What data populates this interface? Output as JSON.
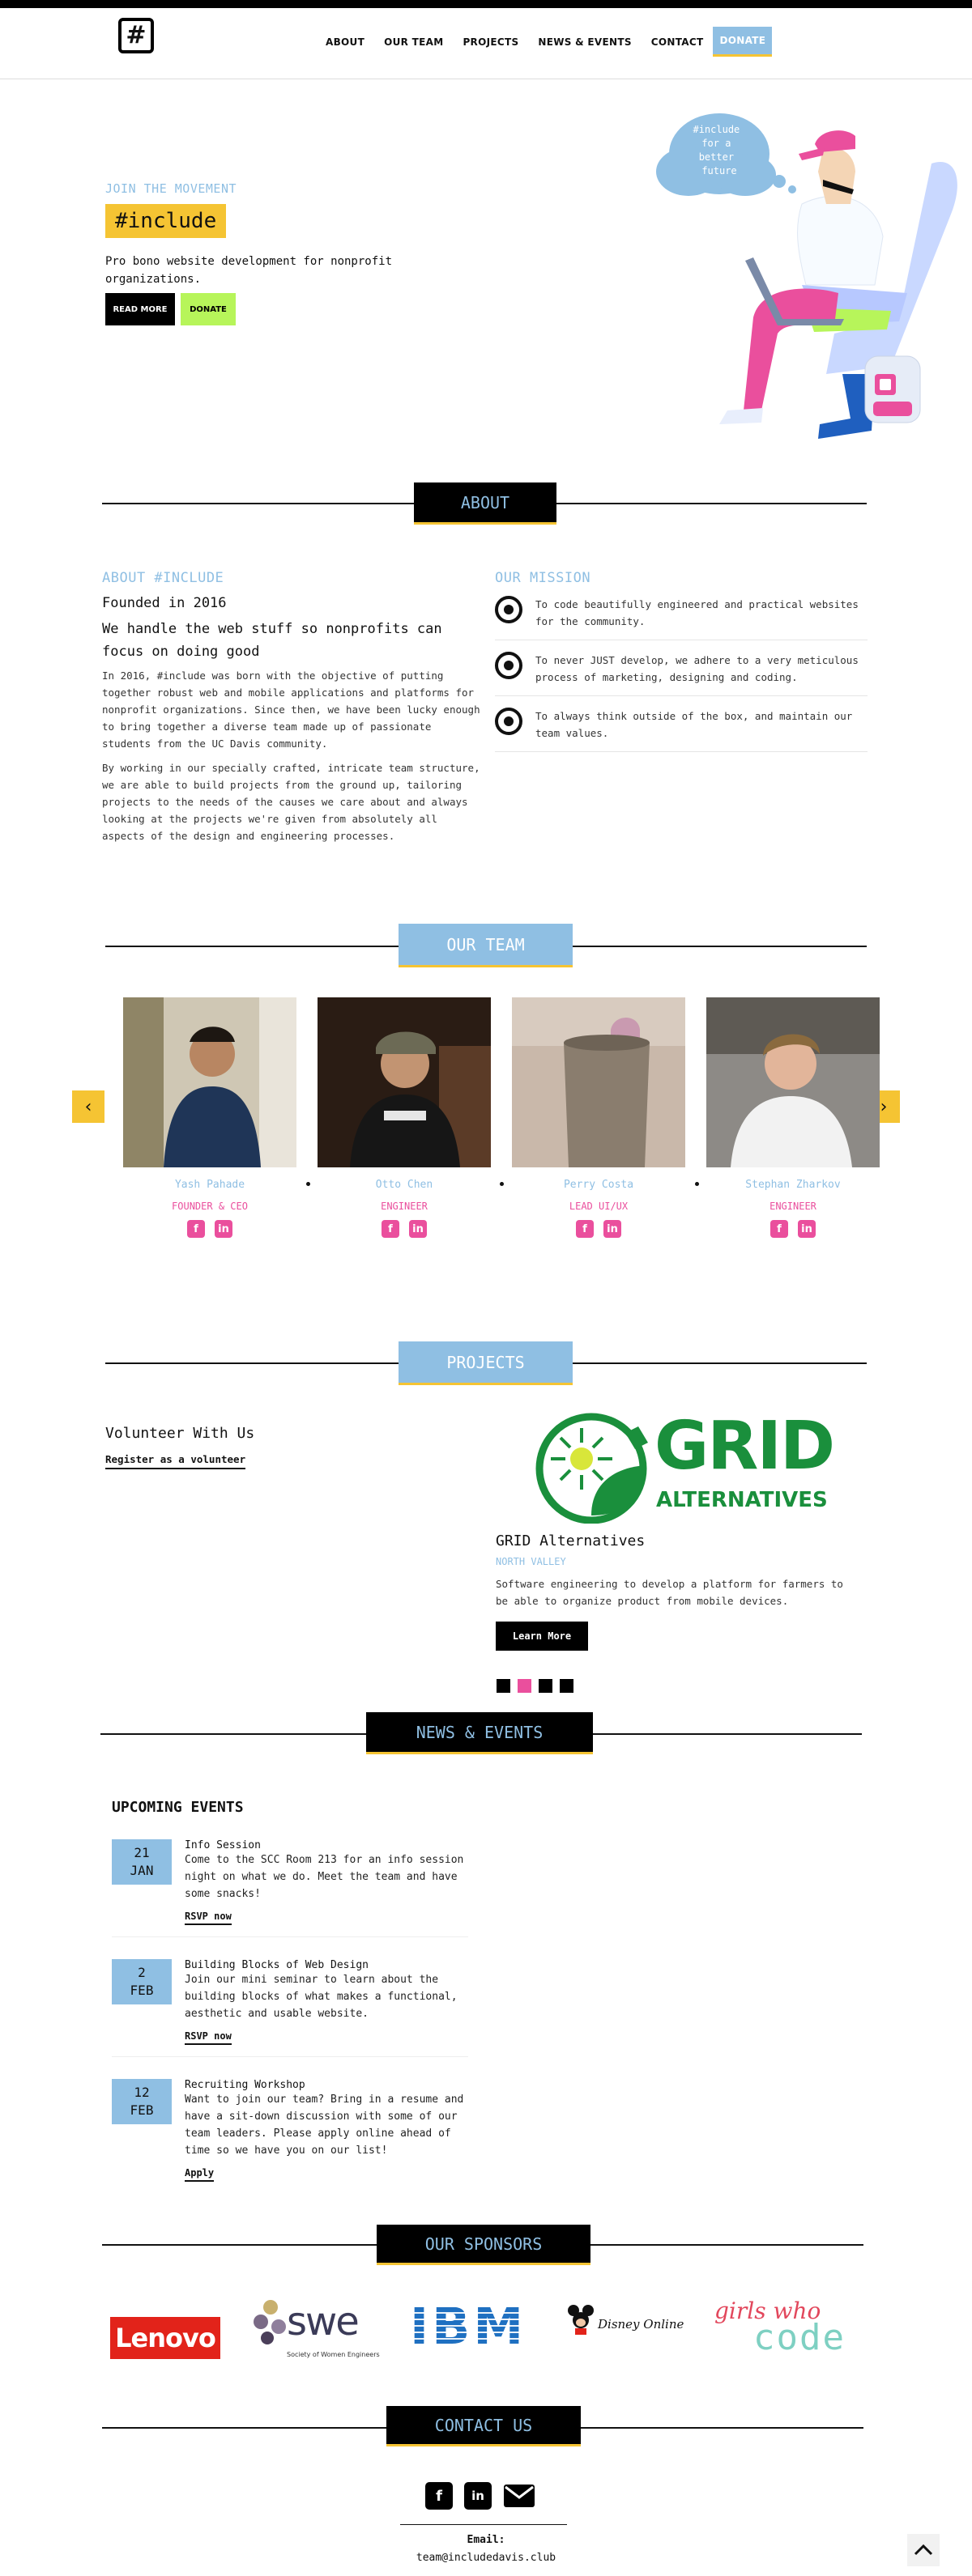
{
  "nav": {
    "logo_glyph": "#",
    "items": [
      "ABOUT",
      "OUR TEAM",
      "PROJECTS",
      "NEWS & EVENTS",
      "CONTACT"
    ],
    "donate": "DONATE"
  },
  "hero": {
    "kicker": "JOIN THE MOVEMENT",
    "title": "#include",
    "text": "Pro bono website development for nonprofit organizations.",
    "read_more": "READ MORE",
    "donate": "DONATE",
    "bubble_text": "#include for a better future"
  },
  "about": {
    "section_title": "ABOUT",
    "heading": "ABOUT #INCLUDE",
    "founded": "Founded in 2016",
    "tagline": "We handle the web stuff so nonprofits can focus on doing good",
    "para1": "In 2016, #include was born with the objective of putting together robust web and mobile applications and platforms for nonprofit organizations. Since then, we have been lucky enough to bring together a diverse team made up of passionate students from the UC Davis community.",
    "para2": "By working in our specially crafted, intricate team structure, we are able to build projects from the ground up, tailoring projects to the needs of the causes we care about and always looking at the projects we're given from absolutely all aspects of the design and engineering processes.",
    "mission_heading": "OUR MISSION",
    "missions": [
      "To code beautifully engineered and practical websites for the community.",
      "To never JUST develop, we adhere to a very meticulous process of marketing, designing and coding.",
      "To always think outside of the box, and maintain our team values."
    ]
  },
  "team": {
    "section_title": "OUR TEAM",
    "members": [
      {
        "name": "Yash Pahade",
        "role": "FOUNDER & CEO"
      },
      {
        "name": "Otto Chen",
        "role": "ENGINEER"
      },
      {
        "name": "Perry Costa",
        "role": "LEAD UI/UX"
      },
      {
        "name": "Stephan Zharkov",
        "role": "ENGINEER"
      }
    ],
    "social_fb": "f",
    "social_in": "in",
    "arrow_left": "‹",
    "arrow_right": "›"
  },
  "projects": {
    "section_title": "PROJECTS",
    "volunteer_heading": "Volunteer With Us",
    "volunteer_link": "Register as a volunteer",
    "logo_word": "GRID",
    "logo_sub": "ALTERNATIVES",
    "project_name": "GRID Alternatives",
    "project_location": "NORTH VALLEY",
    "project_desc": "Software engineering to develop a platform for farmers to be able to organize product from mobile devices.",
    "learn_more": "Learn More",
    "active_slide": 2,
    "slide_count": 4
  },
  "news": {
    "section_title": "NEWS & EVENTS",
    "heading": "UPCOMING EVENTS",
    "events": [
      {
        "day": "21",
        "month": "JAN",
        "title": "Info Session",
        "desc": "Come to the SCC Room 213 for an info session night on what we do. Meet the team and have some snacks!",
        "link": "RSVP now"
      },
      {
        "day": "2",
        "month": "FEB",
        "title": "Building Blocks of Web Design",
        "desc": "Join our mini seminar to learn about the building blocks of what makes a functional, aesthetic and usable website.",
        "link": "RSVP now"
      },
      {
        "day": "12",
        "month": "FEB",
        "title": "Recruiting Workshop",
        "desc": "Want to join our team? Bring in a resume and have a sit-down discussion with some of our team leaders. Please apply online ahead of time so we have you on our list!",
        "link": "Apply"
      }
    ]
  },
  "sponsors": {
    "section_title": "OUR SPONSORS",
    "lenovo": "Lenovo",
    "swe": "swe",
    "swe_sub": "Society of Women Engineers",
    "ibm": "IBM",
    "disney": "Disney Online",
    "gwc_top": "girls who",
    "gwc_bottom": "code"
  },
  "contact": {
    "section_title": "CONTACT US",
    "email_label": "Email:",
    "email": "team@includedavis.club",
    "icons": [
      "facebook-icon",
      "linkedin-icon",
      "mail-icon"
    ]
  },
  "colors": {
    "accent_blue": "#8fbfe3",
    "accent_yellow": "#f5c433",
    "accent_pink": "#ea4f9d",
    "accent_green": "#b7f55a",
    "grid_green": "#1a8f3c"
  }
}
